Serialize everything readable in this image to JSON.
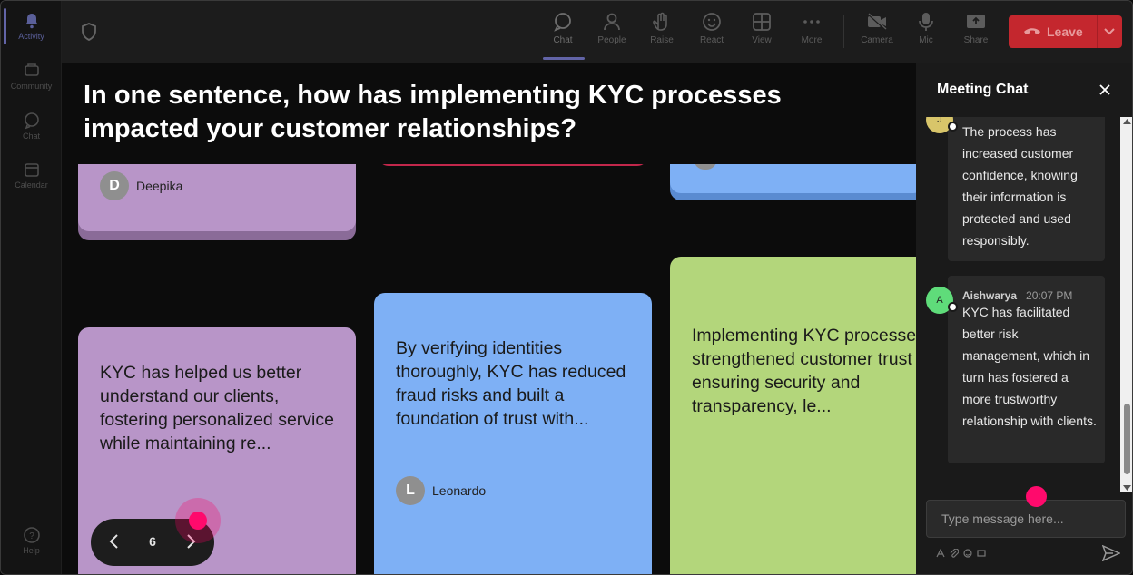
{
  "rail": {
    "items": [
      {
        "label": "Activity",
        "icon": "bell-icon",
        "active": true
      },
      {
        "label": "Community",
        "icon": "community-icon",
        "active": false
      },
      {
        "label": "Chat",
        "icon": "chat-icon",
        "active": false
      },
      {
        "label": "Calendar",
        "icon": "calendar-icon",
        "active": false
      }
    ],
    "help_label": "Help"
  },
  "toolbar": {
    "buttons": [
      {
        "label": "Chat",
        "icon": "chat-bubble-icon"
      },
      {
        "label": "People",
        "icon": "people-icon"
      },
      {
        "label": "Raise",
        "icon": "raise-hand-icon"
      },
      {
        "label": "React",
        "icon": "smiley-icon"
      },
      {
        "label": "View",
        "icon": "grid-view-icon"
      },
      {
        "label": "More",
        "icon": "more-dots-icon"
      },
      {
        "label": "Camera",
        "icon": "camera-off-icon"
      },
      {
        "label": "Mic",
        "icon": "mic-icon"
      },
      {
        "label": "Share",
        "icon": "share-icon"
      }
    ],
    "leave_label": "Leave",
    "leave_color": "#c4272e",
    "accent": "#6264a7"
  },
  "stage": {
    "question": "In one sentence, how has implementing KYC processes impacted your customer relationships?",
    "cards": {
      "purple_top": {
        "author": "Deepika",
        "initial": "D",
        "color": "#b895c8"
      },
      "purple": {
        "text": "KYC has helped us better understand our clients, fostering personalized service while maintaining re...",
        "color": "#b895c8"
      },
      "blue": {
        "text": "By verifying identities thoroughly, KYC has reduced fraud risks and built a foundation of trust with...",
        "author": "Leonardo",
        "initial": "L",
        "color": "#7eb0f5"
      },
      "green": {
        "text": "Implementing KYC processes has strengthened customer trust by ensuring security and transparency, le...",
        "color": "#b3d67b"
      }
    },
    "pager": {
      "page": "6"
    }
  },
  "chat": {
    "title": "Meeting Chat",
    "messages": [
      {
        "initial": "J",
        "avatar_color": "#d8c56a",
        "text": "The process has increased customer confidence, knowing their information is protected and used responsibly."
      },
      {
        "initial": "A",
        "avatar_color": "#5fdc7a",
        "name": "Aishwarya",
        "time": "20:07 PM",
        "text": "KYC has facilitated better risk management, which in turn has fostered a more trustworthy relationship with clients."
      }
    ],
    "compose_placeholder": "Type message here..."
  }
}
